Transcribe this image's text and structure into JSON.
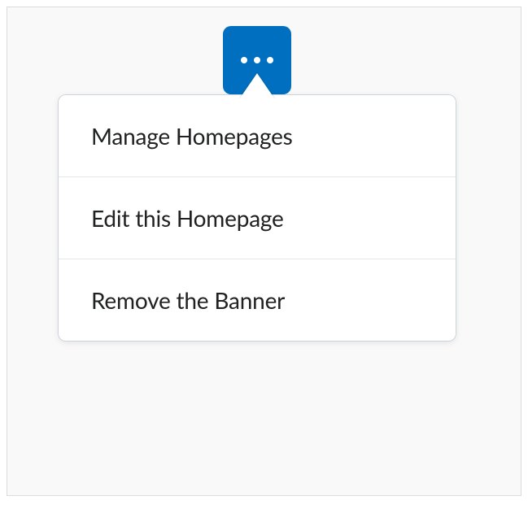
{
  "button": {
    "name": "more-actions",
    "icon": "more-horizontal-icon"
  },
  "menu": {
    "items": [
      {
        "label": "Manage Homepages"
      },
      {
        "label": "Edit this Homepage"
      },
      {
        "label": "Remove the Banner"
      }
    ]
  }
}
